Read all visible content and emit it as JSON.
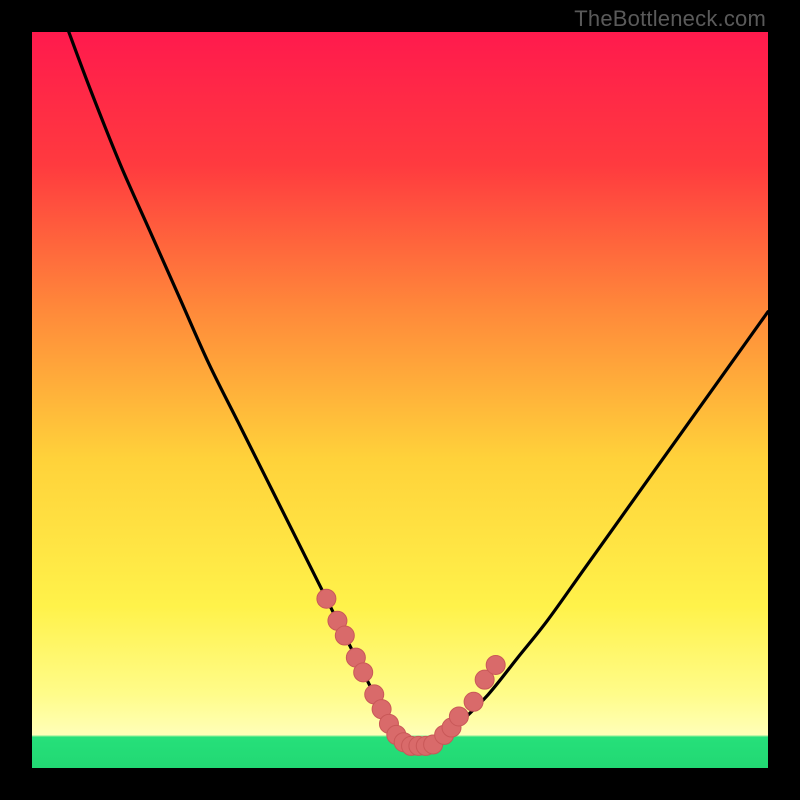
{
  "watermark": "TheBottleneck.com",
  "colors": {
    "black": "#000000",
    "curve": "#000000",
    "marker_fill": "#d96a6a",
    "marker_stroke": "#c95858",
    "green": "#26e07a",
    "gradient_stops": [
      {
        "offset": 0.0,
        "color": "#ff1a4d"
      },
      {
        "offset": 0.18,
        "color": "#ff3a3f"
      },
      {
        "offset": 0.38,
        "color": "#ff8a3a"
      },
      {
        "offset": 0.58,
        "color": "#ffd23a"
      },
      {
        "offset": 0.78,
        "color": "#fff24a"
      },
      {
        "offset": 0.9,
        "color": "#fffc8a"
      },
      {
        "offset": 0.955,
        "color": "#ffffb8"
      },
      {
        "offset": 0.958,
        "color": "#26e07a"
      },
      {
        "offset": 1.0,
        "color": "#22d873"
      }
    ]
  },
  "chart_data": {
    "type": "line",
    "title": "",
    "xlabel": "",
    "ylabel": "",
    "xlim": [
      0,
      100
    ],
    "ylim": [
      0,
      100
    ],
    "grid": false,
    "series": [
      {
        "name": "bottleneck-curve",
        "x": [
          5,
          8,
          12,
          16,
          20,
          24,
          28,
          32,
          36,
          40,
          42,
          44,
          46,
          47,
          48,
          49,
          50,
          51,
          52,
          53,
          54,
          56,
          58,
          62,
          66,
          70,
          75,
          80,
          85,
          90,
          95,
          100
        ],
        "y": [
          100,
          92,
          82,
          73,
          64,
          55,
          47,
          39,
          31,
          23,
          19,
          15,
          11,
          9,
          7,
          5,
          4,
          3,
          3,
          3,
          3,
          4,
          6,
          10,
          15,
          20,
          27,
          34,
          41,
          48,
          55,
          62
        ]
      }
    ],
    "markers": {
      "name": "highlight-points",
      "x": [
        40,
        41.5,
        42.5,
        44,
        45,
        46.5,
        47.5,
        48.5,
        49.5,
        50.5,
        51.5,
        52.5,
        53.5,
        54.5,
        56,
        57,
        58,
        60,
        61.5,
        63
      ],
      "y": [
        23,
        20,
        18,
        15,
        13,
        10,
        8,
        6,
        4.5,
        3.5,
        3,
        3,
        3,
        3.2,
        4.5,
        5.5,
        7,
        9,
        12,
        14
      ]
    }
  }
}
